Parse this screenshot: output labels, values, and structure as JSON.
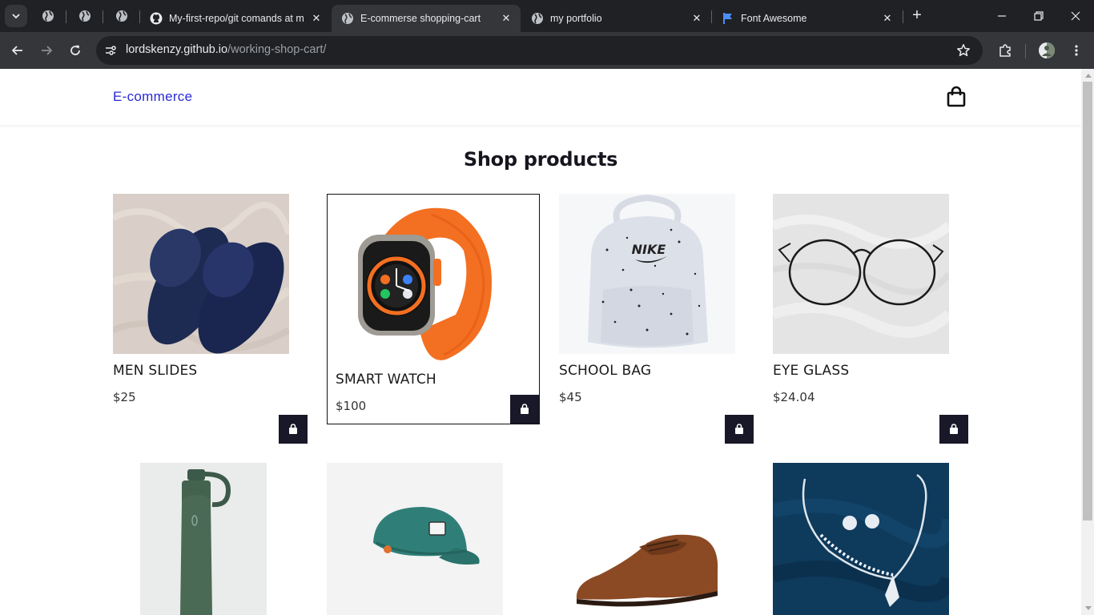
{
  "browser": {
    "tabs": [
      {
        "label": "My-first-repo/git comands at m",
        "favicon": "github-icon",
        "active": false
      },
      {
        "label": "E-commerse shopping-cart",
        "favicon": "globe-icon",
        "active": true
      },
      {
        "label": "my portfolio",
        "favicon": "globe-icon",
        "active": false
      },
      {
        "label": "Font Awesome",
        "favicon": "flag-icon",
        "active": false
      }
    ],
    "close_glyph": "✕",
    "new_tab_glyph": "+",
    "url_host": "lordskenzy.github.io",
    "url_path": "/working-shop-cart/"
  },
  "site": {
    "logo": "E-commerce",
    "title": "Shop products",
    "products": [
      {
        "name": "MEN SLIDES",
        "price": "$25"
      },
      {
        "name": "SMART WATCH",
        "price": "$100"
      },
      {
        "name": "SCHOOL BAG",
        "price": "$45"
      },
      {
        "name": "EYE GLASS",
        "price": "$24.04"
      }
    ]
  },
  "colors": {
    "logo": "#2a2ad4",
    "button": "#181828",
    "chrome_dark": "#202124",
    "chrome_toolbar": "#35363a"
  }
}
